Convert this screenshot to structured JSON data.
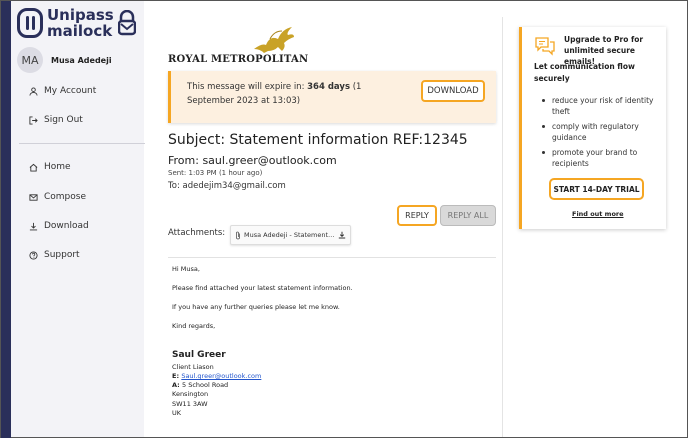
{
  "app": {
    "logo_line1": "Unipass",
    "logo_line2": "mailock"
  },
  "user": {
    "initials": "MA",
    "name": "Musa Adedeji"
  },
  "sidebar": {
    "items": [
      {
        "label": "My Account",
        "icon": "user-icon"
      },
      {
        "label": "Sign Out",
        "icon": "sign-out-icon"
      },
      {
        "label": "Home",
        "icon": "home-icon"
      },
      {
        "label": "Compose",
        "icon": "mail-icon"
      },
      {
        "label": "Download",
        "icon": "download-icon"
      },
      {
        "label": "Support",
        "icon": "help-icon"
      }
    ]
  },
  "brand": {
    "name": "ROYAL METROPOLITAN",
    "logo_color": "#c9a227"
  },
  "notice": {
    "prefix": "This message will expire in: ",
    "days": "364 days",
    "suffix": " (1 September 2023 at 13:03)",
    "download_label": "DOWNLOAD"
  },
  "email": {
    "subject": "Subject: Statement information REF:12345",
    "from": "From: saul.greer@outlook.com",
    "sent": "Sent: 1:03 PM (1 hour ago)",
    "to": "To: adedejim34@gmail.com",
    "reply_label": "REPLY",
    "reply_all_label": "REPLY ALL",
    "attachments_label": "Attachments:",
    "attachment_name": "Musa Adedeji - Statement do...",
    "body": [
      "Hi Musa,",
      "Please find attached your latest statement information.",
      "If you have any further queries please let me know.",
      "Kind regards,"
    ],
    "signature": {
      "name": "Saul Greer",
      "title": "Client Liason",
      "email_prefix": "E: ",
      "email": "Saul.greer@outlook.com",
      "address_prefix": "A: ",
      "address": "5 School Road",
      "city": "Kensington",
      "postcode": "SW11 3AW",
      "country": "UK"
    }
  },
  "promo": {
    "title": "Upgrade to Pro for unlimited secure emails!",
    "subtitle": "Let communication flow securely",
    "bullets": [
      "reduce your risk of identity theft",
      "comply with regulatory guidance",
      "promote your brand to recipients"
    ],
    "cta": "START 14-DAY TRIAL",
    "link": "Find out more"
  },
  "colors": {
    "accent": "#f5a623",
    "brand_navy": "#2a2f5a",
    "sidebar_bg": "#f3f3f7",
    "notice_bg": "#fdf0e0"
  }
}
